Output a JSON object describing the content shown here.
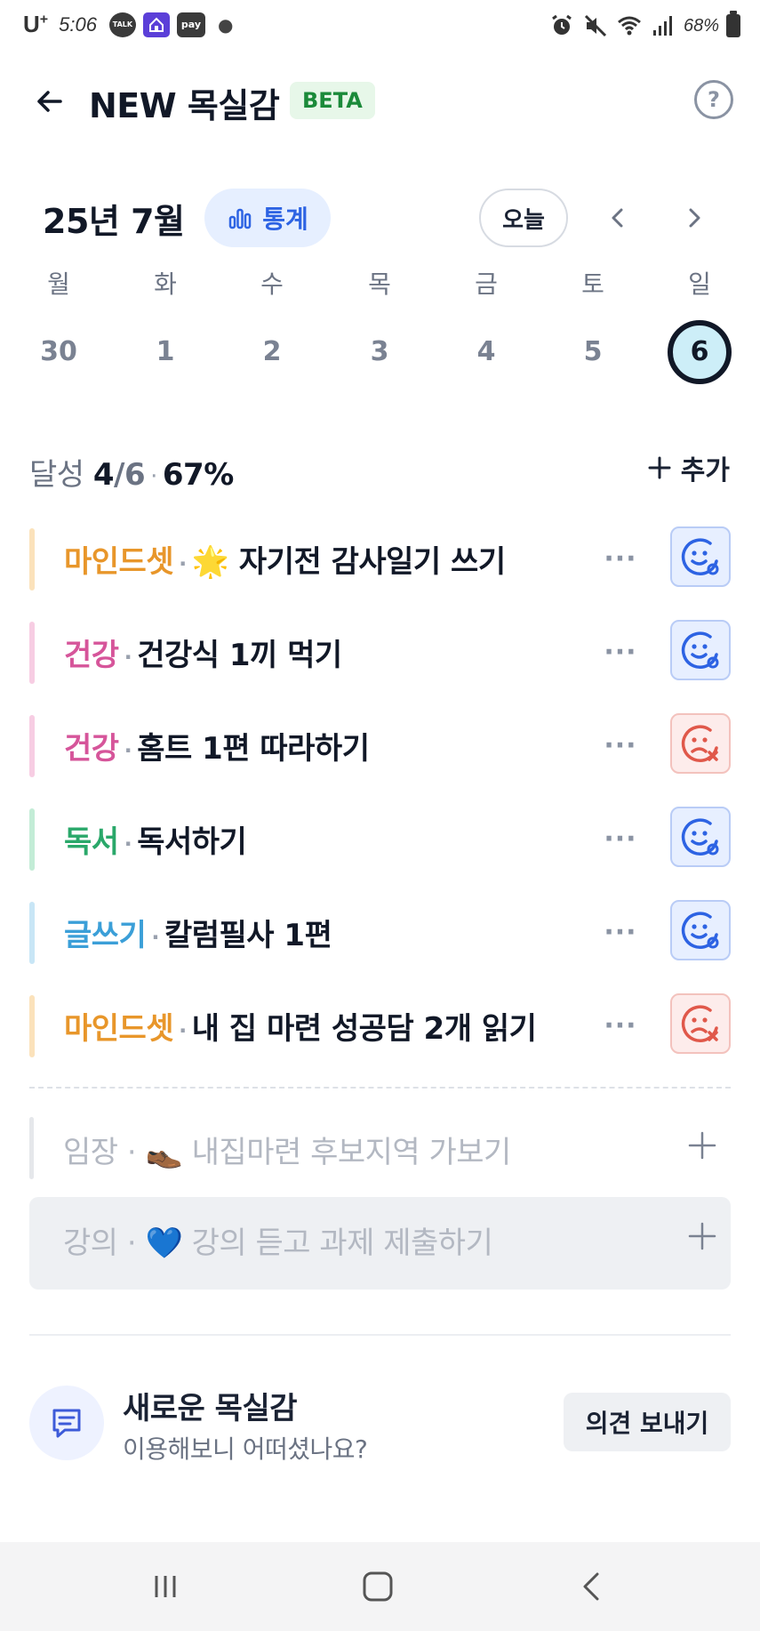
{
  "status_bar": {
    "carrier": "U",
    "carrier_sup": "+",
    "time": "5:06",
    "badges": [
      "TALK",
      "pay"
    ],
    "battery": "68%"
  },
  "header": {
    "title": "NEW 목실감",
    "beta": "BETA",
    "help_glyph": "?"
  },
  "calendar": {
    "month": "25년 7월",
    "stats_label": "통계",
    "today_label": "오늘",
    "days": [
      {
        "weekday": "월",
        "date": "30"
      },
      {
        "weekday": "화",
        "date": "1"
      },
      {
        "weekday": "수",
        "date": "2"
      },
      {
        "weekday": "목",
        "date": "3"
      },
      {
        "weekday": "금",
        "date": "4"
      },
      {
        "weekday": "토",
        "date": "5"
      },
      {
        "weekday": "일",
        "date": "6",
        "selected": true
      }
    ]
  },
  "achievement": {
    "label": "달성",
    "done": "4",
    "total": "/6",
    "percent": "67%",
    "add_label": "추가"
  },
  "habits": [
    {
      "category": "마인드셋",
      "title": "🌟 자기전 감사일기 쓰기",
      "status": "done",
      "color": "#e8962a",
      "bar": "#fbe2bb"
    },
    {
      "category": "건강",
      "title": "건강식 1끼 먹기",
      "status": "done",
      "color": "#d6559a",
      "bar": "#f7cde3"
    },
    {
      "category": "건강",
      "title": "홈트 1편 따라하기",
      "status": "fail",
      "color": "#d6559a",
      "bar": "#f7cde3"
    },
    {
      "category": "독서",
      "title": "독서하기",
      "status": "done",
      "color": "#2aa86a",
      "bar": "#c3ecd6"
    },
    {
      "category": "글쓰기",
      "title": "칼럼필사 1편",
      "status": "done",
      "color": "#3b9fd8",
      "bar": "#c8e6f6"
    },
    {
      "category": "마인드셋",
      "title": "내 집 마련 성공담 2개 읽기",
      "status": "fail",
      "color": "#e8962a",
      "bar": "#fbe2bb"
    }
  ],
  "suggestions": [
    {
      "category": "임장",
      "title": "👞 내집마련 후보지역 가보기"
    },
    {
      "category": "강의",
      "title": "💙 강의 듣고 과제 제출하기"
    }
  ],
  "feedback": {
    "title": "새로운 목실감",
    "subtitle": "이용해보니 어떠셨나요?",
    "button": "의견 보내기"
  },
  "colors": {
    "accent": "#2d63e3",
    "done_status": "#2d63e3",
    "fail_status": "#e0584a"
  }
}
